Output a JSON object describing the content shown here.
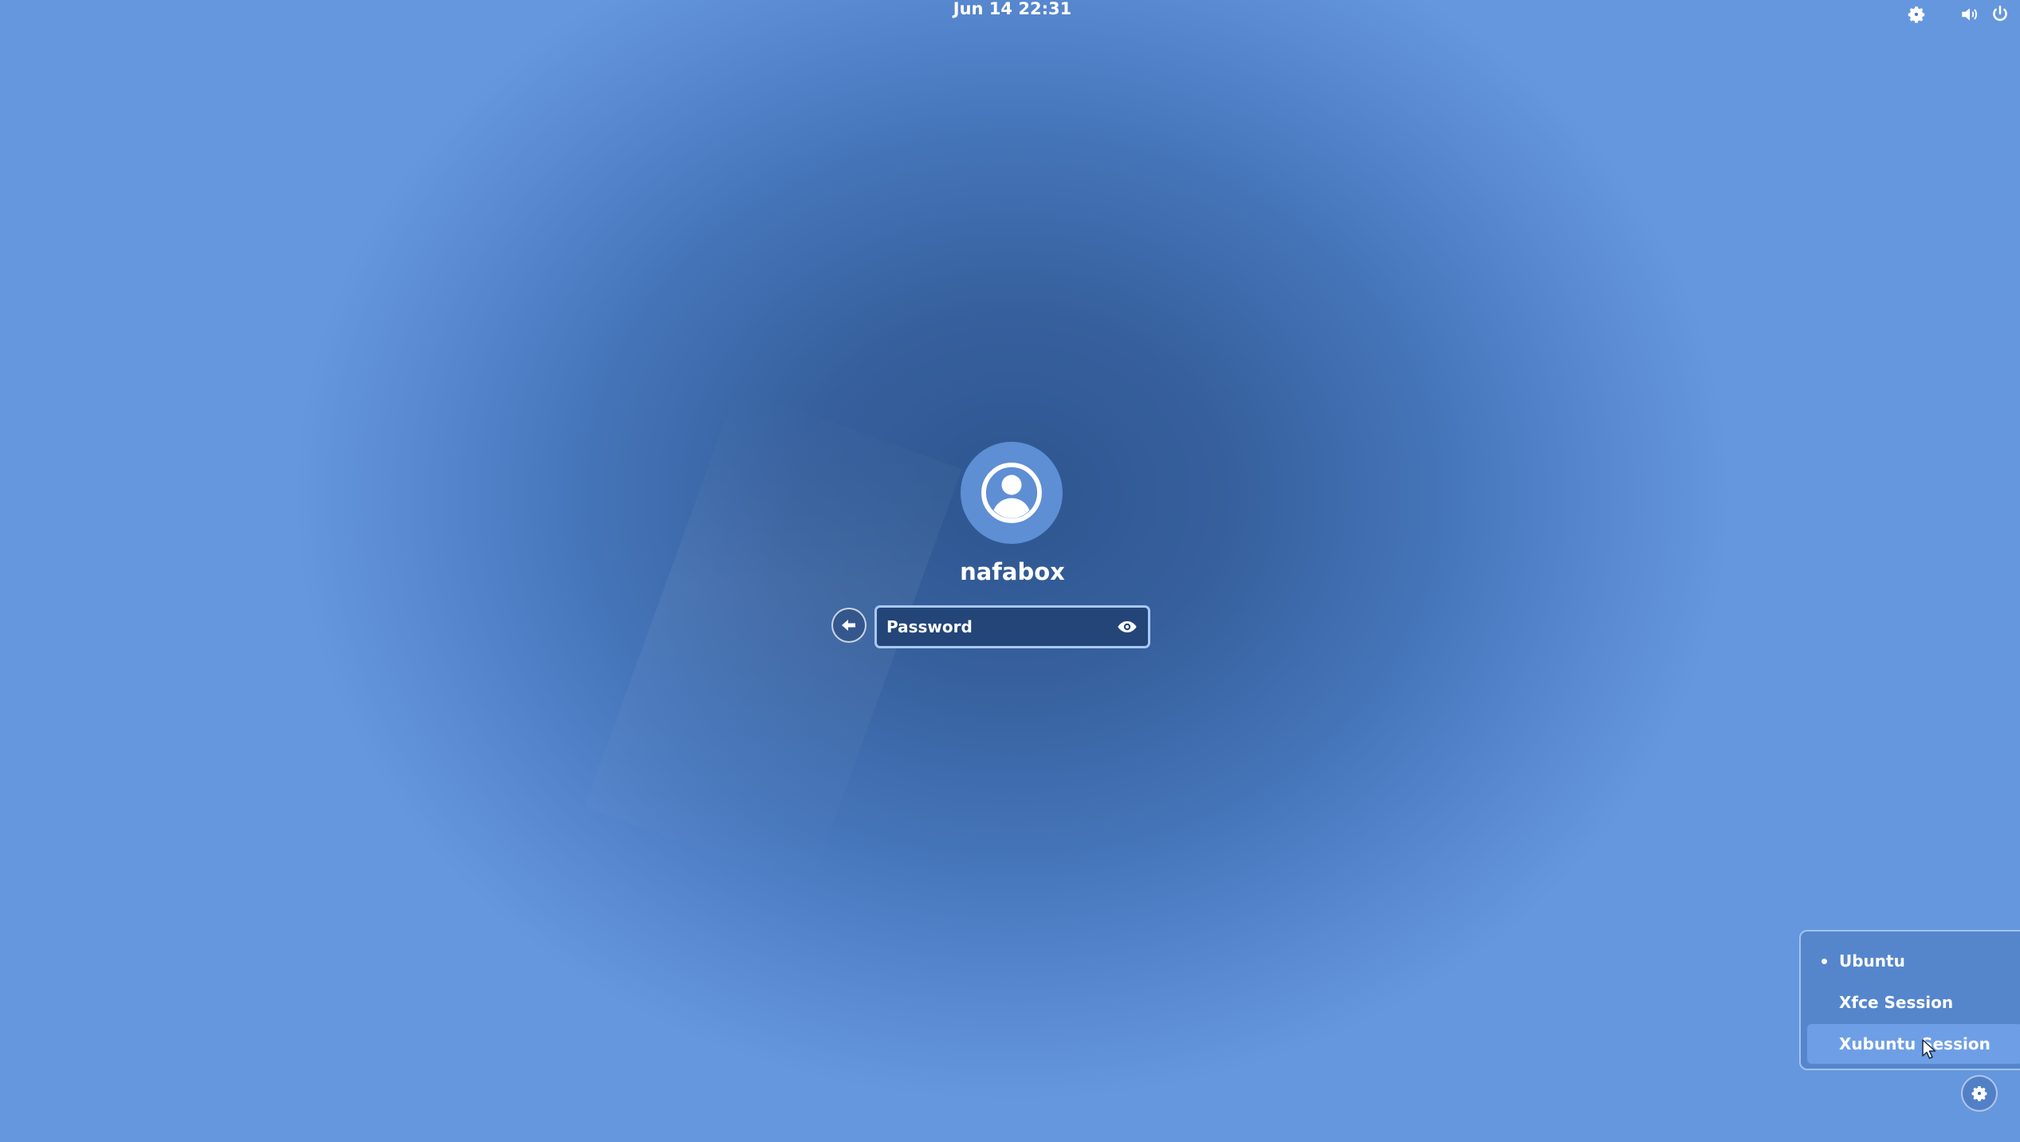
{
  "top_bar": {
    "clock": "Jun 14  22:31",
    "accessibility_icon": "accessibility-gear-icon",
    "volume_icon": "volume-icon",
    "power_icon": "power-icon"
  },
  "login": {
    "avatar_icon": "user-avatar-icon",
    "username": "nafabox",
    "back_icon": "back-arrow-icon",
    "password_placeholder": "Password",
    "password_value": "",
    "reveal_icon": "eye-icon"
  },
  "session_menu": {
    "items": [
      {
        "label": "Ubuntu",
        "active": true
      },
      {
        "label": "Xfce Session",
        "active": false
      },
      {
        "label": "Xubuntu Session",
        "active": false,
        "hovered": true
      }
    ],
    "settings_icon": "gear-icon"
  },
  "colors": {
    "background_center": "#2e5690",
    "background_edge": "#6497de",
    "field_border": "#a9c8f5",
    "field_fill": "#234578",
    "menu_highlight": "#6e9fe6"
  }
}
